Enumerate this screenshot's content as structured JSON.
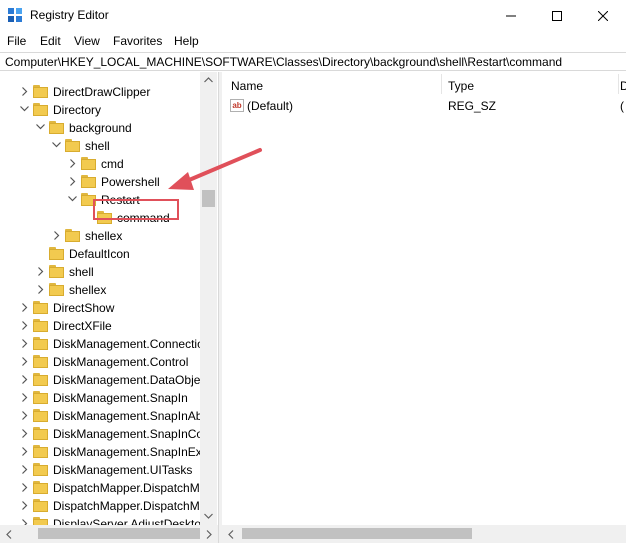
{
  "window": {
    "title": "Registry Editor"
  },
  "menu": [
    "File",
    "Edit",
    "View",
    "Favorites",
    "Help"
  ],
  "address": "Computer\\HKEY_LOCAL_MACHINE\\SOFTWARE\\Classes\\Directory\\background\\shell\\Restart\\command",
  "tree": {
    "items": [
      {
        "label": "DirectDrawClipper",
        "level": 1,
        "expander": "collapsed"
      },
      {
        "label": "Directory",
        "level": 1,
        "expander": "expanded"
      },
      {
        "label": "background",
        "level": 2,
        "expander": "expanded"
      },
      {
        "label": "shell",
        "level": 3,
        "expander": "expanded"
      },
      {
        "label": "cmd",
        "level": 4,
        "expander": "collapsed"
      },
      {
        "label": "Powershell",
        "level": 4,
        "expander": "collapsed"
      },
      {
        "label": "Restart",
        "level": 4,
        "expander": "expanded"
      },
      {
        "label": "command",
        "level": 5,
        "expander": "none",
        "selected": true
      },
      {
        "label": "shellex",
        "level": 3,
        "expander": "collapsed"
      },
      {
        "label": "DefaultIcon",
        "level": 2,
        "expander": "none"
      },
      {
        "label": "shell",
        "level": 2,
        "expander": "collapsed"
      },
      {
        "label": "shellex",
        "level": 2,
        "expander": "collapsed"
      },
      {
        "label": "DirectShow",
        "level": 1,
        "expander": "collapsed"
      },
      {
        "label": "DirectXFile",
        "level": 1,
        "expander": "collapsed"
      },
      {
        "label": "DiskManagement.Connectio",
        "level": 1,
        "expander": "collapsed"
      },
      {
        "label": "DiskManagement.Control",
        "level": 1,
        "expander": "collapsed"
      },
      {
        "label": "DiskManagement.DataObje",
        "level": 1,
        "expander": "collapsed"
      },
      {
        "label": "DiskManagement.SnapIn",
        "level": 1,
        "expander": "collapsed"
      },
      {
        "label": "DiskManagement.SnapInAb",
        "level": 1,
        "expander": "collapsed"
      },
      {
        "label": "DiskManagement.SnapInCo",
        "level": 1,
        "expander": "collapsed"
      },
      {
        "label": "DiskManagement.SnapInExt",
        "level": 1,
        "expander": "collapsed"
      },
      {
        "label": "DiskManagement.UITasks",
        "level": 1,
        "expander": "collapsed"
      },
      {
        "label": "DispatchMapper.DispatchM",
        "level": 1,
        "expander": "collapsed"
      },
      {
        "label": "DispatchMapper.DispatchM",
        "level": 1,
        "expander": "collapsed"
      },
      {
        "label": "DisplayServer.AdjustDesktop",
        "level": 1,
        "expander": "collapsed"
      }
    ]
  },
  "list": {
    "columns": [
      "Name",
      "Type",
      "D"
    ],
    "rows": [
      {
        "name": "(Default)",
        "type": "REG_SZ",
        "data": "("
      }
    ]
  },
  "icons": {
    "app": "registry-icon",
    "folder": "folder-icon",
    "value": "string-value-icon"
  },
  "colors": {
    "selection_outline": "#e0505a",
    "folder": "#f2ca4f",
    "arrow": "#e0505a"
  }
}
